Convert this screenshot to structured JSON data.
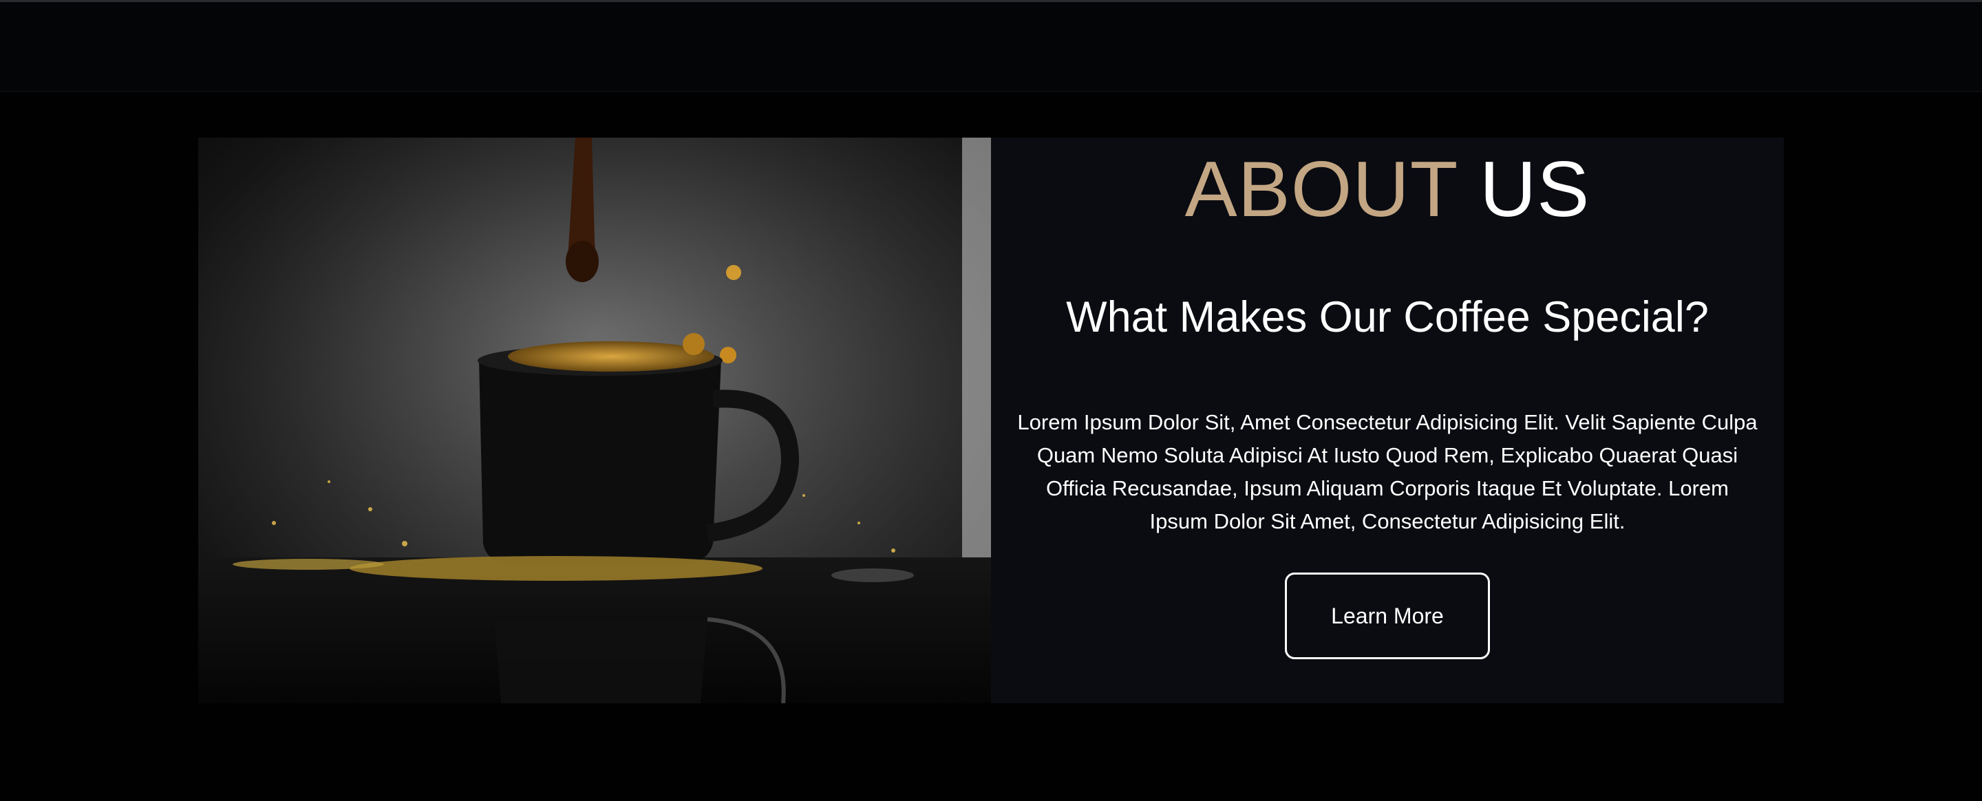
{
  "about": {
    "title_accent": "ABOUT",
    "title_plain": "US",
    "subtitle": "What Makes Our Coffee Special?",
    "body": "Lorem Ipsum Dolor Sit, Amet Consectetur Adipisicing Elit. Velit Sapiente Culpa Quam Nemo Soluta Adipisci At Iusto Quod Rem, Explicabo Quaerat Quasi Officia Recusandae, Ipsum Aliquam Corporis Itaque Et Voluptate. Lorem Ipsum Dolor Sit Amet, Consectetur Adipisicing Elit.",
    "button_label": "Learn More",
    "image": "coffee-cup-splash-photo"
  },
  "colors": {
    "page_background": "#010101",
    "header_background": "#040507",
    "content_background": "#0b0c12",
    "accent": "#c3a683",
    "text": "#ffffff"
  }
}
